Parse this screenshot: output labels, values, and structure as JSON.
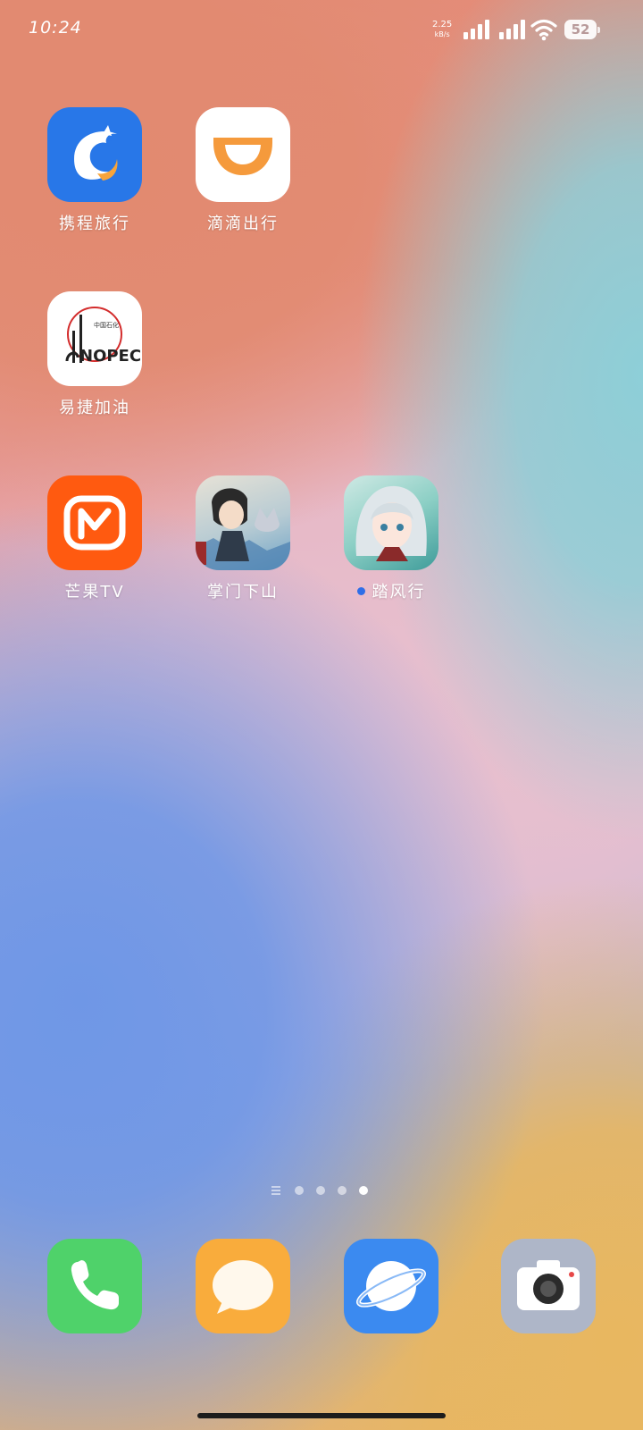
{
  "status_bar": {
    "time": "10:24",
    "net_speed_value": "2.25",
    "net_speed_unit": "kB/s",
    "battery": "52"
  },
  "apps": [
    {
      "label": "携程旅行",
      "icon": "ctrip-dolphin-icon",
      "color": "#2877e8"
    },
    {
      "label": "滴滴出行",
      "icon": "didi-icon",
      "color": "#f59a3c"
    },
    {
      "label": "易捷加油",
      "icon": "sinopec-icon",
      "color": "#ffffff"
    },
    {
      "label": "芒果TV",
      "icon": "mango-tv-icon",
      "color": "#ff5a10"
    },
    {
      "label": "掌门下山",
      "icon": "zhangmen-game-icon",
      "color": "#9ec3d6"
    },
    {
      "label": "踏风行",
      "icon": "tafengxing-game-icon",
      "color": "#86c9c0"
    }
  ],
  "page_indicator": {
    "pages": 4,
    "active_page": 4
  },
  "dock": [
    {
      "name": "phone",
      "icon": "phone-icon",
      "color": "#4fd26a"
    },
    {
      "name": "messages",
      "icon": "message-bubble-icon",
      "color": "#f9ac3c"
    },
    {
      "name": "browser",
      "icon": "planet-icon",
      "color": "#3b8af0"
    },
    {
      "name": "camera",
      "icon": "camera-icon",
      "color": "#aeb6c8"
    }
  ]
}
